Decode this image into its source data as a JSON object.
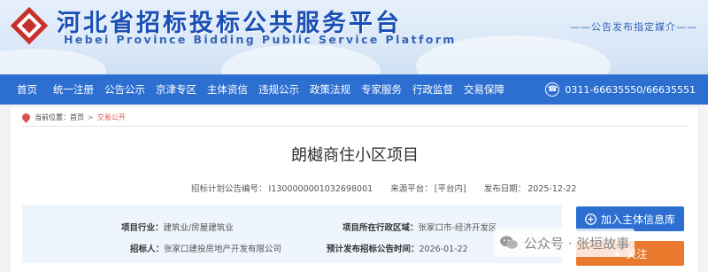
{
  "header": {
    "title": "河北省招标投标公共服务平台",
    "subtitle": "Hebei Province Bidding Public Service Platform",
    "slogan": "——公告发布指定媒介——",
    "colors": {
      "brand": "#1a4fb5",
      "nav": "#2c6fd1"
    }
  },
  "nav": {
    "items": [
      {
        "label": "首页"
      },
      {
        "label": "统一注册"
      },
      {
        "label": "公告公示"
      },
      {
        "label": "京津专区"
      },
      {
        "label": "主体资信"
      },
      {
        "label": "违规公示"
      },
      {
        "label": "政策法规"
      },
      {
        "label": "专家服务"
      },
      {
        "label": "行政监督"
      },
      {
        "label": "交易保障"
      }
    ],
    "phone": "0311-66635550/66635551"
  },
  "breadcrumb": {
    "prefix": "当前位置：",
    "home": "首页",
    "sep": ">",
    "current": "交易公开"
  },
  "notice": {
    "title": "朗樾商住小区项目",
    "code_label": "招标计划公告编号：",
    "code": "I1300000001032698001",
    "source_label": "来源平台：",
    "source": "[平台内]",
    "date_label": "发布日期：",
    "date": "2025-12-22"
  },
  "info": {
    "industry_label": "项目行业：",
    "industry": "建筑业/房屋建筑业",
    "region_label": "项目所在行政区域：",
    "region": "张家口市-经济开发区",
    "tenderer_label": "招标人：",
    "tenderer": "张家口建投房地产开发有限公司",
    "expected_label": "预计发布招标公告时间：",
    "expected": "2026-01-22"
  },
  "actions": {
    "add_label": "加入主体信息库",
    "follow_label": "关注",
    "add_icon": "plus-circle-icon",
    "follow_icon": "star-icon"
  },
  "watermark": {
    "text": "公众号 · 张垣故事"
  }
}
